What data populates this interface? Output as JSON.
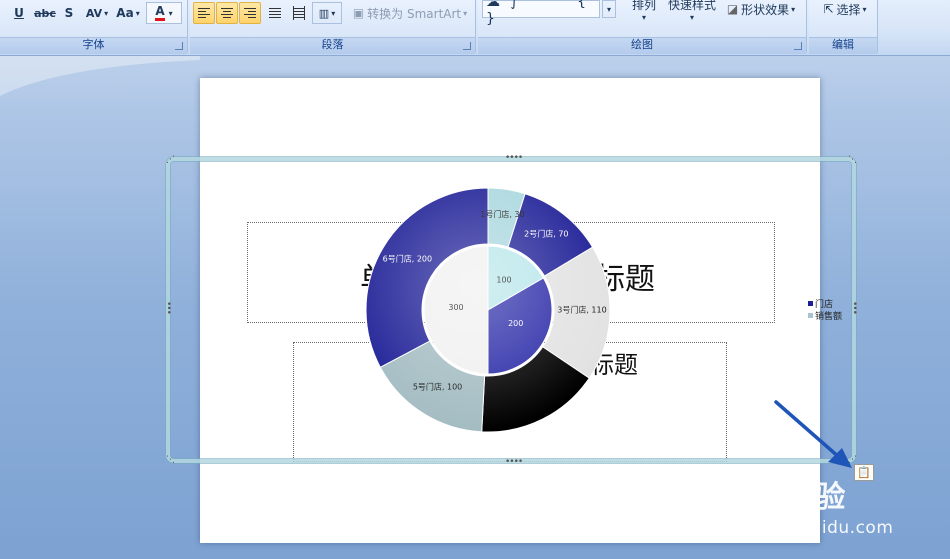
{
  "ribbon": {
    "font_group": {
      "label": "字体",
      "underline": "U",
      "strikethrough": "abc",
      "shadow": "S",
      "spacing": "AV",
      "case": "Aa",
      "font_color": "A"
    },
    "paragraph_group": {
      "label": "段落",
      "smartart": "转换为 SmartArt"
    },
    "drawing_group": {
      "label": "绘图",
      "arrange": "排列",
      "quick_styles": "快速样式",
      "shape_effects": "形状效果"
    },
    "editing_group": {
      "label": "编辑",
      "select": "选择"
    }
  },
  "slide": {
    "title_partial_left": "单",
    "title_partial_right": "标题",
    "subtitle_partial": "标题"
  },
  "chart_data": {
    "type": "pie",
    "variant": "doughnut",
    "series": [
      {
        "name": "门店",
        "ring": "outer",
        "slices": [
          {
            "label": "1号门店, 30",
            "value": 30,
            "color": "#a9d7de"
          },
          {
            "label": "2号门店, 70",
            "value": 70,
            "color": "#1e1f96"
          },
          {
            "label": "3号门店, 110",
            "value": 110,
            "color": "#e2e2e2"
          },
          {
            "label": "",
            "value": 100,
            "color": "#000000"
          },
          {
            "label": "5号门店, 100",
            "value": 100,
            "color": "#a3bcc2"
          },
          {
            "label": "6号门店, 200",
            "value": 200,
            "color": "#1e1f96"
          }
        ]
      },
      {
        "name": "销售额",
        "ring": "inner",
        "slices": [
          {
            "label": "100",
            "value": 100,
            "color": "#b8e6ea"
          },
          {
            "label": "200",
            "value": 200,
            "color": "#2a2aa8"
          },
          {
            "label": "300",
            "value": 300,
            "color": "#f0f0f0"
          }
        ]
      }
    ],
    "legend": {
      "placement": "right",
      "entries": [
        {
          "label": "门店",
          "color": "#1e1f96"
        },
        {
          "label": "销售额",
          "color": "#a9c4d0"
        }
      ]
    }
  },
  "watermark": {
    "brand": "Bai经验",
    "url": "jingyan.baidu.com"
  },
  "icons": [
    "paste-options-icon",
    "annotation-arrow-icon"
  ],
  "colors": {
    "ribbon_label": "#15428b",
    "arrow": "#1f55b8",
    "frame": "#b4d7e1"
  }
}
